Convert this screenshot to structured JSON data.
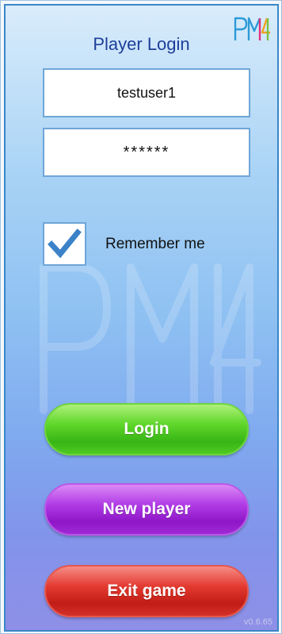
{
  "login": {
    "title": "Player Login",
    "username_value": "testuser1",
    "password_value": "******",
    "remember_label": "Remember me",
    "remember_checked": true,
    "buttons": {
      "login": "Login",
      "new_player": "New player",
      "exit": "Exit game"
    },
    "version": "v0.6.65"
  },
  "branding": {
    "logo": "PM4I",
    "watermark": "PM4I"
  },
  "colors": {
    "title": "#1d3f9a",
    "login_button": "#4fc822",
    "new_player_button": "#a02ad6",
    "exit_button": "#d3302a",
    "checkmark": "#3b82c8"
  },
  "icons": {
    "check": "check-icon",
    "logo": "pm4i-logo-icon",
    "watermark": "pm4i-watermark-icon"
  }
}
